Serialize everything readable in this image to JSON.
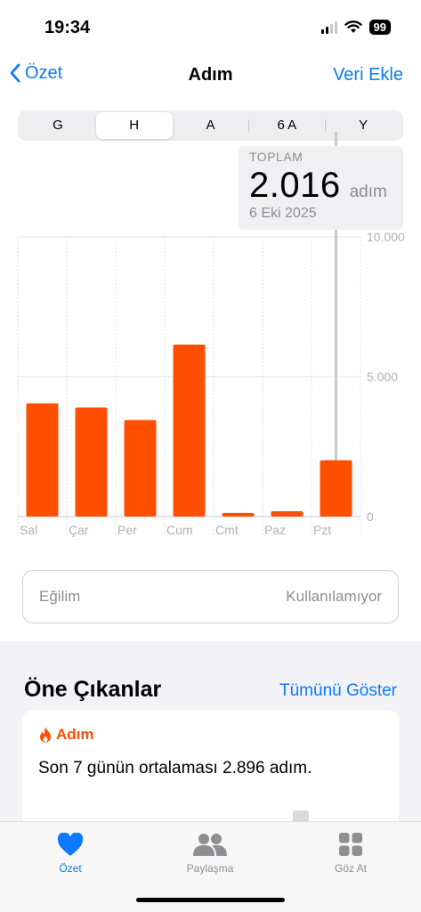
{
  "status": {
    "time": "19:34",
    "battery": "99"
  },
  "nav": {
    "back_label": "Özet",
    "title": "Adım",
    "action_label": "Veri Ekle"
  },
  "segments": [
    {
      "label": "G"
    },
    {
      "label": "H",
      "selected": true
    },
    {
      "label": "A"
    },
    {
      "label": "6 A"
    },
    {
      "label": "Y"
    }
  ],
  "tooltip": {
    "label": "TOPLAM",
    "value": "2.016",
    "unit": "adım",
    "date": "6 Eki 2025"
  },
  "chart_data": {
    "type": "bar",
    "categories": [
      "Sal",
      "Çar",
      "Per",
      "Cum",
      "Cmt",
      "Paz",
      "Pzt"
    ],
    "values": [
      4050,
      3900,
      3450,
      6150,
      130,
      190,
      2016
    ],
    "y_ticks": [
      "10.000",
      "5.000",
      "0"
    ],
    "ylim": [
      0,
      10000
    ],
    "selected_index": 6,
    "bar_color": "#ff4f00",
    "grid": true
  },
  "trend": {
    "label": "Eğilim",
    "value": "Kullanılamıyor"
  },
  "highlights": {
    "title": "Öne Çıkanlar",
    "link": "Tümünü Göster",
    "card": {
      "category": "Adım",
      "text": "Son 7 günün ortalaması 2.896 adım."
    }
  },
  "tabs": [
    {
      "label": "Özet",
      "icon": "heart-icon",
      "active": true
    },
    {
      "label": "Paylaşma",
      "icon": "people-icon",
      "active": false
    },
    {
      "label": "Göz At",
      "icon": "grid-icon",
      "active": false
    }
  ],
  "colors": {
    "accent": "#0a7aff",
    "bar": "#ff4f00"
  }
}
